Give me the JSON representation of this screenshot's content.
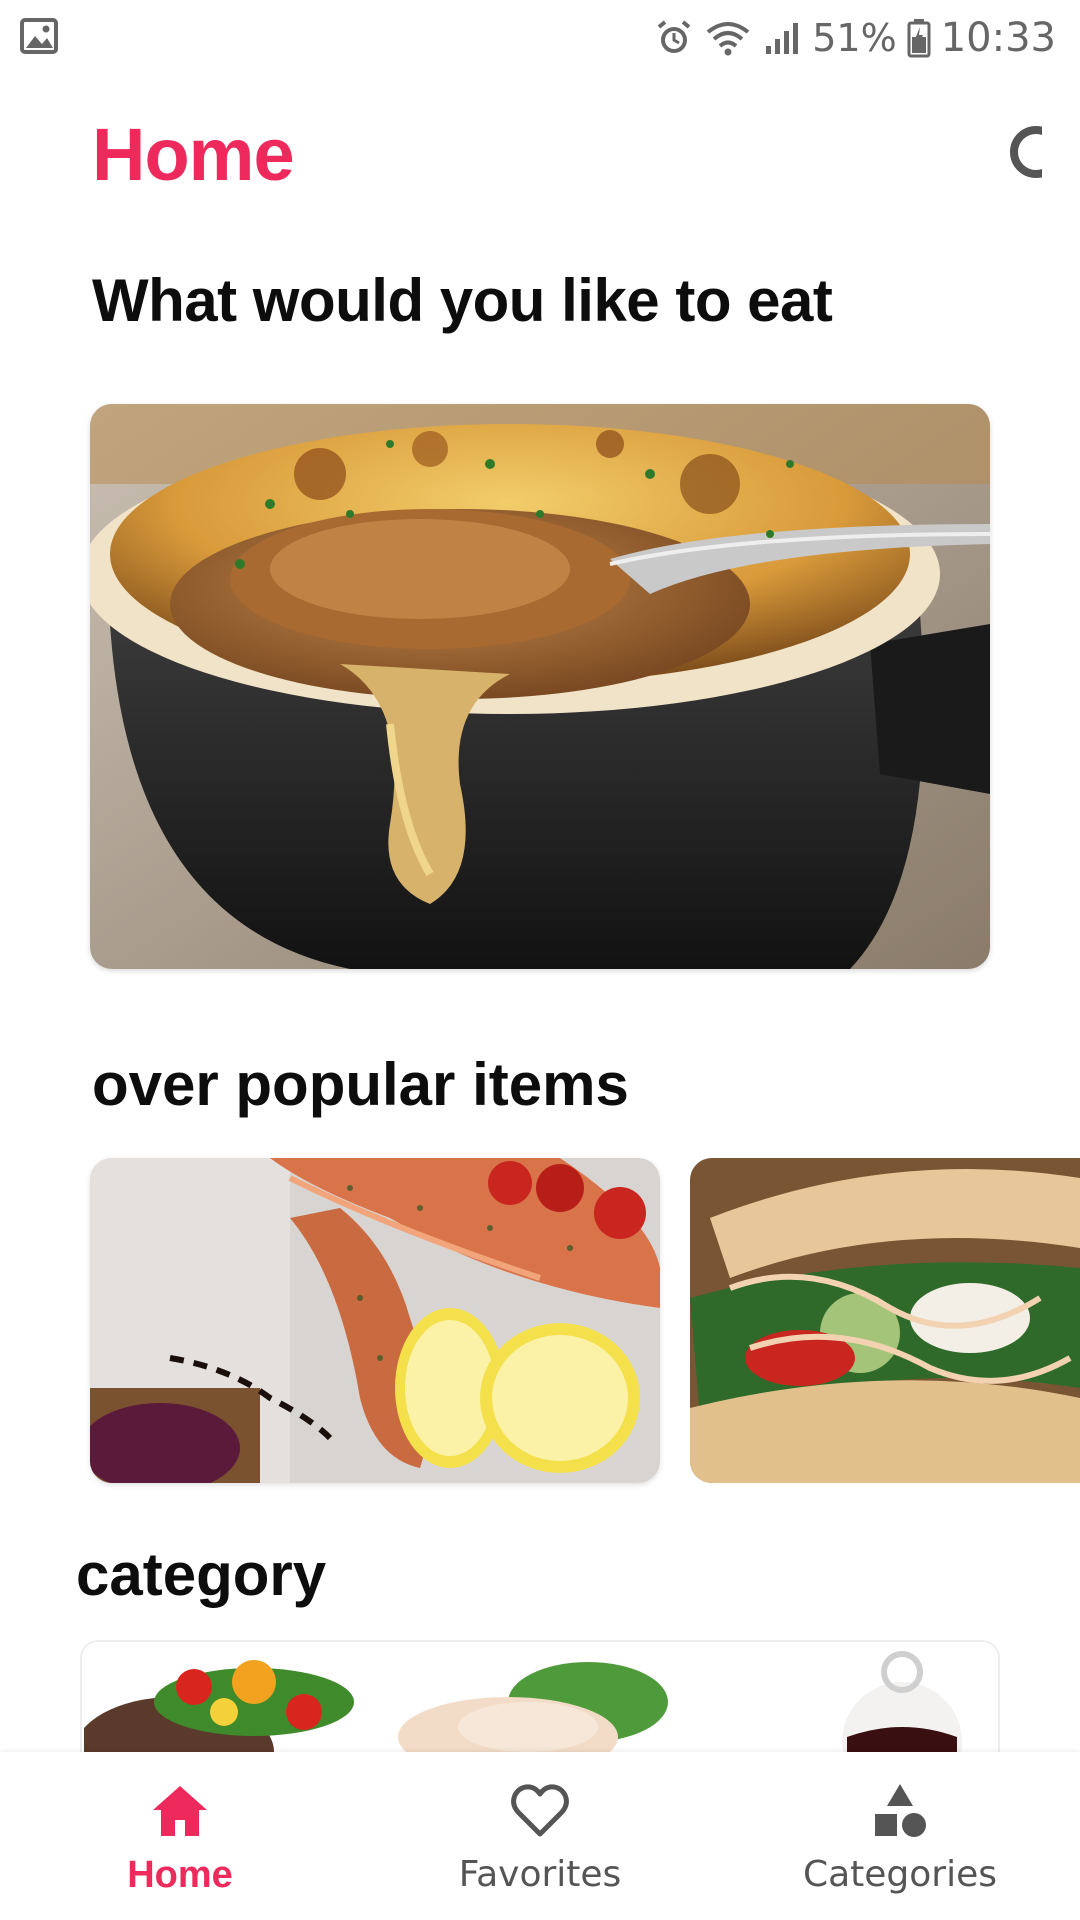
{
  "status_bar": {
    "battery_percent": "51%",
    "time": "10:33",
    "icons": [
      "gallery-icon",
      "alarm-icon",
      "wifi-icon",
      "signal-icon",
      "battery-icon"
    ]
  },
  "header": {
    "title": "Home",
    "question": "What would you like to eat"
  },
  "sections": {
    "popular_title": "over popular items",
    "category_title": "category"
  },
  "images": {
    "hero": "french-onion-soup",
    "popular": [
      "salmon-with-lemon",
      "fish-tacos"
    ],
    "categories": [
      "steak-salad",
      "chicken",
      "dessert"
    ]
  },
  "bottom_nav": {
    "items": [
      {
        "label": "Home",
        "icon": "home-icon",
        "active": true
      },
      {
        "label": "Favorites",
        "icon": "heart-icon",
        "active": false
      },
      {
        "label": "Categories",
        "icon": "shapes-icon",
        "active": false
      }
    ]
  },
  "colors": {
    "accent": "#ee2a5c",
    "text_dark": "#0d0d0d",
    "nav_inactive": "#555555"
  }
}
